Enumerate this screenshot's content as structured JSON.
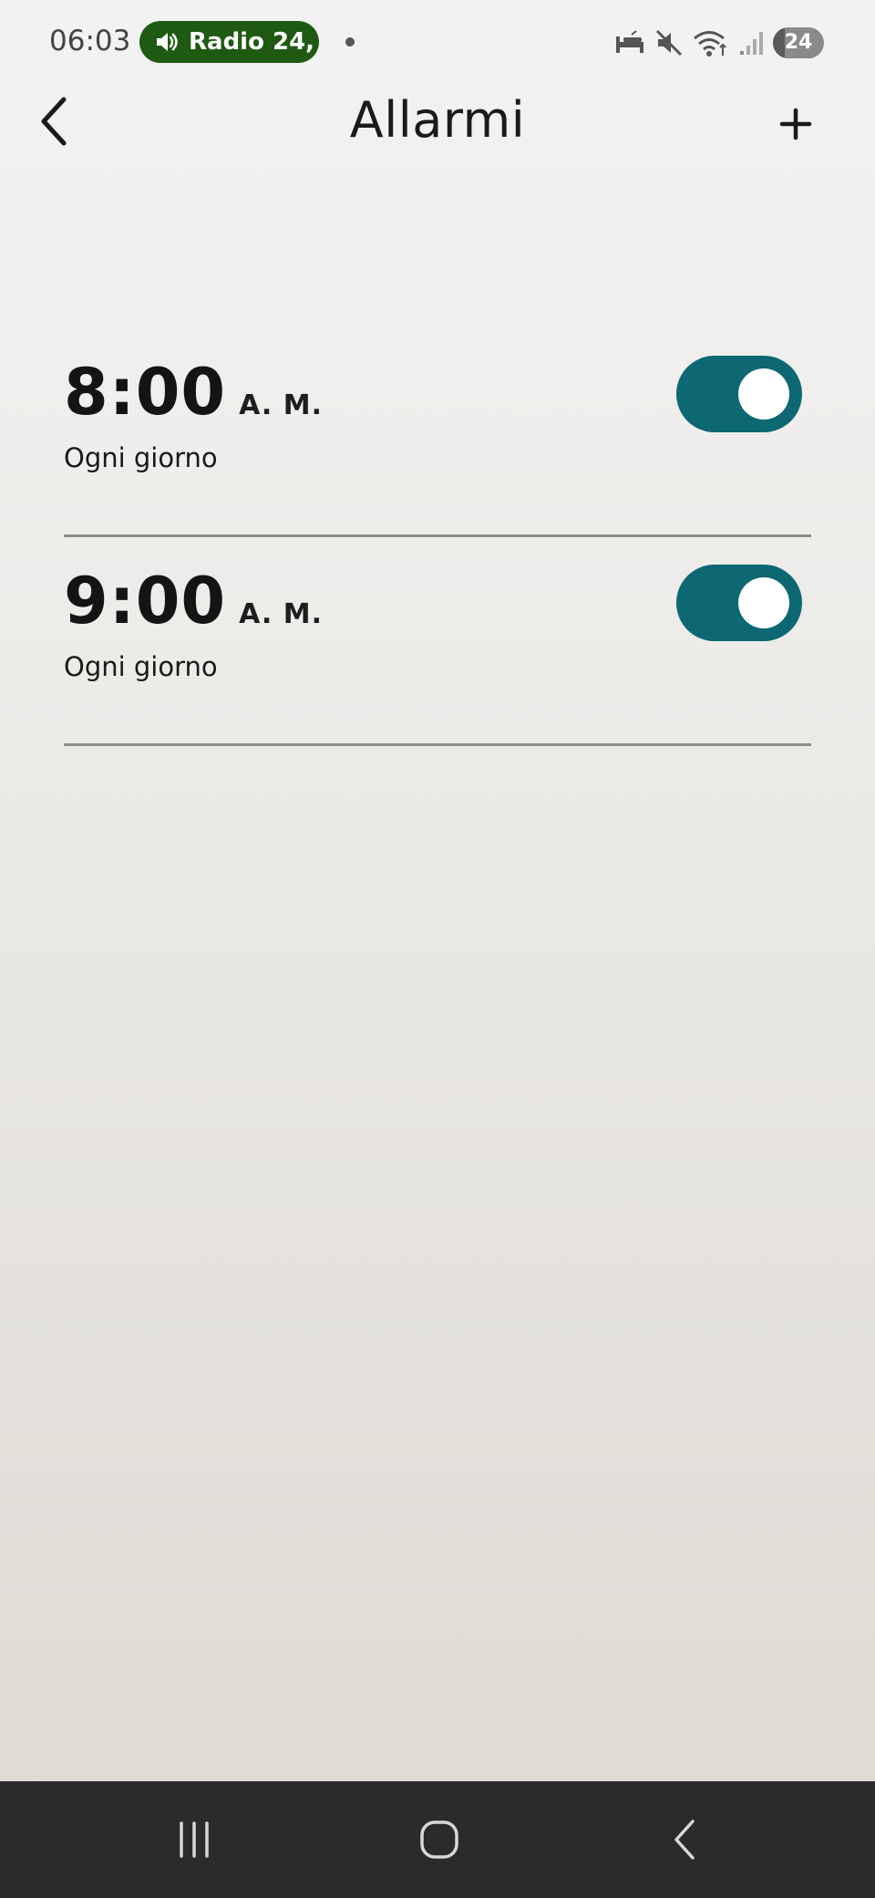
{
  "status_bar": {
    "time": "06:03",
    "media": {
      "label": "Radio 24,"
    },
    "battery": {
      "level": "24",
      "level_fraction": 0.24
    }
  },
  "header": {
    "title": "Allarmi"
  },
  "alarms": [
    {
      "time": "8:00",
      "period": "A. M.",
      "repeat": "Ogni giorno",
      "enabled": true
    },
    {
      "time": "9:00",
      "period": "A. M.",
      "repeat": "Ogni giorno",
      "enabled": true
    }
  ],
  "icons": {
    "back": "chevron-left-icon",
    "add": "plus-icon",
    "media": "speaker-icon",
    "nav_recents": "recents-icon",
    "nav_home": "home-icon",
    "nav_back": "back-icon"
  },
  "colors": {
    "toggle_on": "#0d6873",
    "toggle_off": "#a8a8a8",
    "media_pill": "#1e5a12",
    "nav_bar": "#2b2b2b",
    "divider": "#8c8c8c"
  }
}
